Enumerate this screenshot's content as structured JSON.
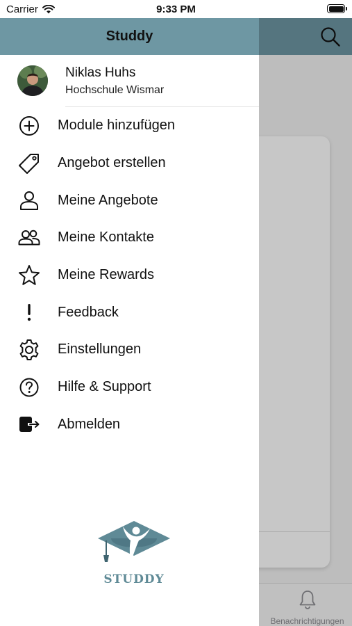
{
  "status_bar": {
    "carrier": "Carrier",
    "time": "9:33 PM"
  },
  "drawer": {
    "title": "Studdy",
    "profile": {
      "name": "Niklas Huhs",
      "university": "Hochschule Wismar"
    },
    "menu": [
      {
        "label": "Module hinzufügen",
        "icon": "plus-circle-icon"
      },
      {
        "label": "Angebot erstellen",
        "icon": "tag-icon"
      },
      {
        "label": "Meine Angebote",
        "icon": "person-icon"
      },
      {
        "label": "Meine Kontakte",
        "icon": "people-icon"
      },
      {
        "label": "Meine Rewards",
        "icon": "star-icon"
      },
      {
        "label": "Feedback",
        "icon": "exclamation-icon"
      },
      {
        "label": "Einstellungen",
        "icon": "gear-icon"
      },
      {
        "label": "Hilfe & Support",
        "icon": "question-circle-icon"
      },
      {
        "label": "Abmelden",
        "icon": "logout-icon"
      }
    ],
    "logo_text": "STUDDY"
  },
  "background": {
    "tabbar": {
      "notifications_label": "Benachrichtigungen"
    }
  },
  "colors": {
    "header": "#6e97a3",
    "logo": "#5f8a96"
  }
}
